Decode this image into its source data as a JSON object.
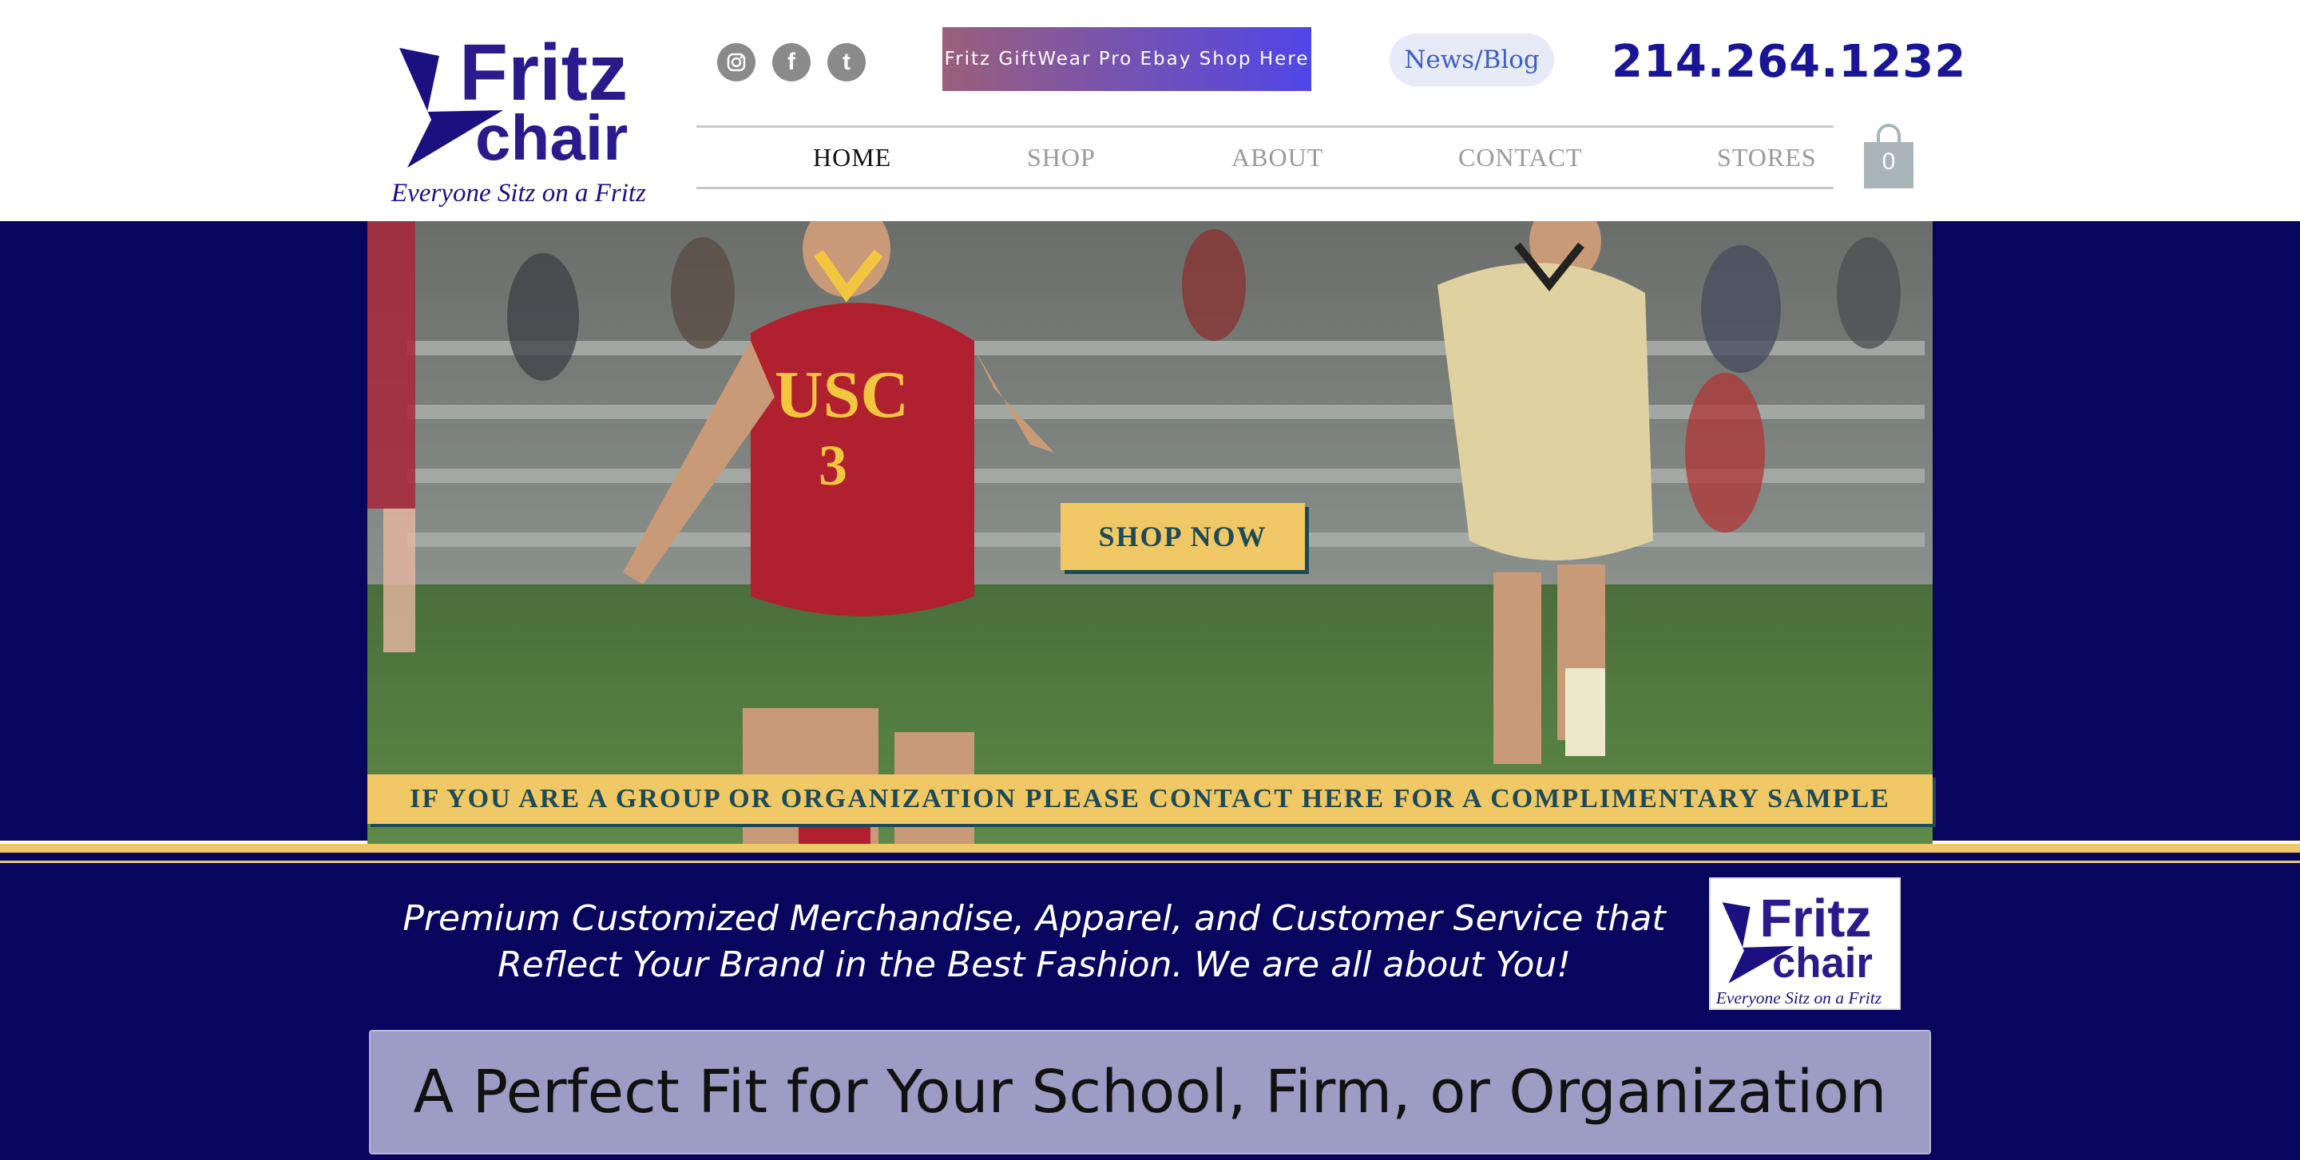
{
  "brand": {
    "logo_word1": "Fritz",
    "logo_word2": "chair",
    "logo_slogan": "Everyone Sitz on a Fritz",
    "colors": {
      "navy": "#07055e",
      "brand_purple": "#2a1a8c",
      "gold": "#f0c865",
      "teal_text": "#1e4a57"
    }
  },
  "header": {
    "socials": [
      {
        "name": "instagram-icon"
      },
      {
        "name": "facebook-icon",
        "glyph": "f"
      },
      {
        "name": "tumblr-icon",
        "glyph": "t"
      }
    ],
    "ebay_button": "Fritz GiftWear Pro Ebay Shop Here",
    "news_button": "News/Blog",
    "phone": "214.264.1232",
    "nav": [
      "HOME",
      "SHOP",
      "ABOUT",
      "CONTACT",
      "STORES"
    ],
    "nav_active": "HOME",
    "cart_count": "0"
  },
  "hero": {
    "shop_now": "SHOP NOW",
    "jersey_text": "USC",
    "jersey_number": "3",
    "promo_banner": "IF YOU ARE A GROUP OR ORGANIZATION PLEASE CONTACT HERE FOR A COMPLIMENTARY SAMPLE"
  },
  "about": {
    "tagline_line1": "Premium Customized Merchandise, Apparel, and Customer Service that",
    "tagline_line2": "Reflect Your Brand in the Best Fashion. We are all about You!",
    "headline": "A Perfect Fit for Your School, Firm, or Organization"
  }
}
